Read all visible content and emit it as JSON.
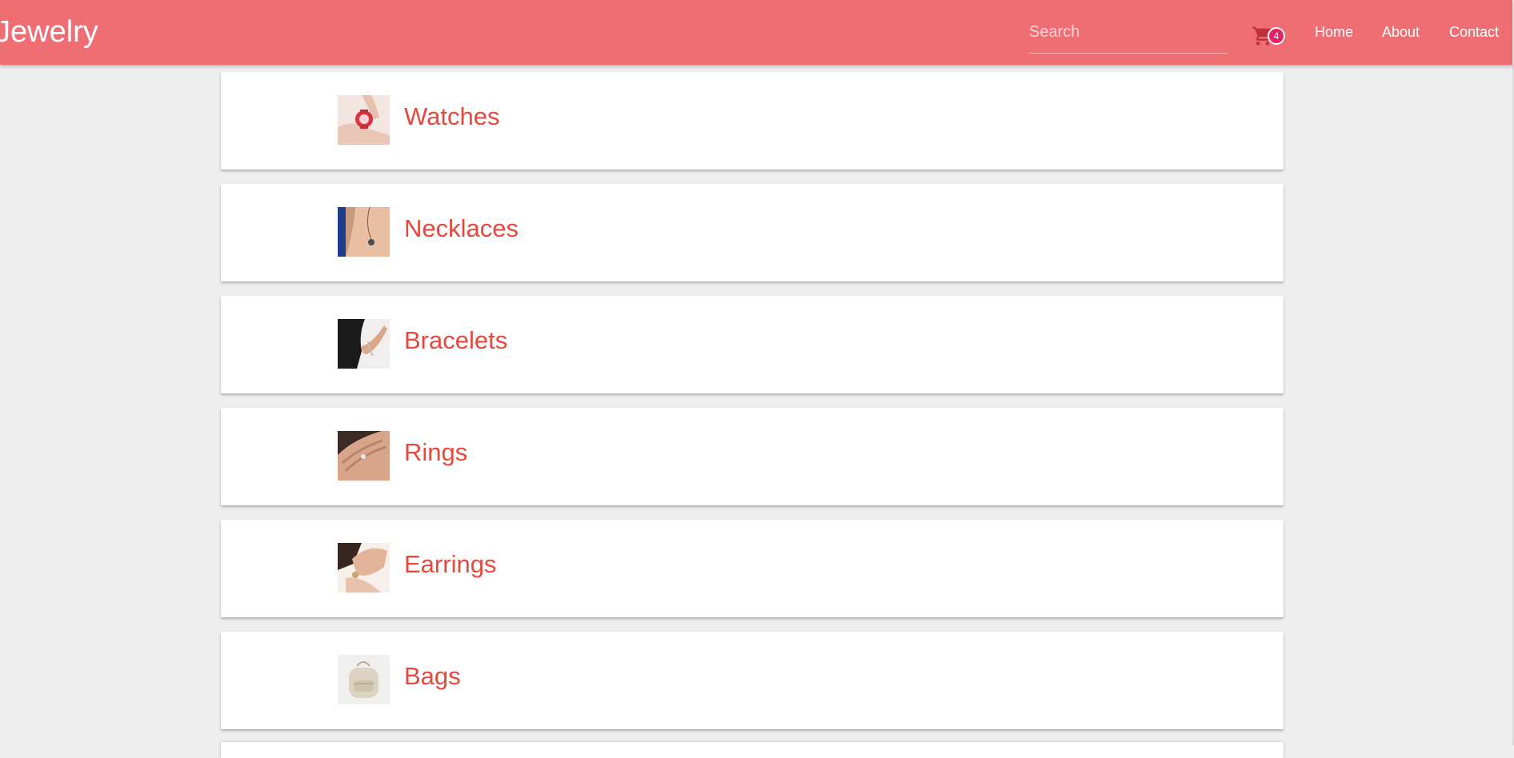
{
  "app": {
    "brand": "Jewelry"
  },
  "header": {
    "search_placeholder": "Search",
    "cart_count": "4",
    "cart_icon": "shopping-cart-icon",
    "nav": [
      {
        "label": "Home"
      },
      {
        "label": "About"
      },
      {
        "label": "Contact"
      }
    ]
  },
  "categories": [
    {
      "label": "Watches",
      "image": "watch-photo"
    },
    {
      "label": "Necklaces",
      "image": "necklace-photo"
    },
    {
      "label": "Bracelets",
      "image": "bracelet-photo"
    },
    {
      "label": "Rings",
      "image": "ring-photo"
    },
    {
      "label": "Earrings",
      "image": "earring-photo"
    },
    {
      "label": "Bags",
      "image": "bag-photo"
    }
  ],
  "colors": {
    "header_bg": "#ef6e74",
    "accent_text": "#e8473c",
    "badge": "#e91e63",
    "page_bg": "#eeeeee"
  }
}
